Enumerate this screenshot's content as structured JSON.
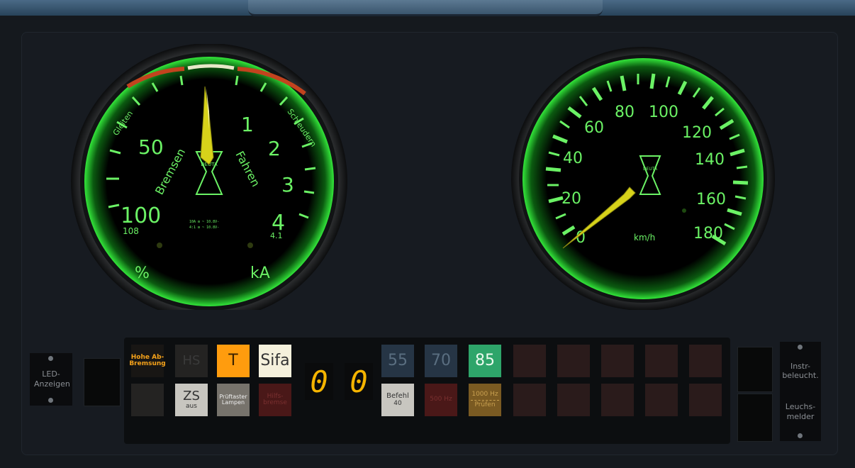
{
  "gauges": {
    "traction": {
      "arc_left": "Gleiten",
      "arc_right": "Schleudern",
      "label_left": "Bremsen",
      "label_right": "Fahren",
      "logo": "DEUTA",
      "ticks_left": [
        "50",
        "100"
      ],
      "ticks_right": [
        "1",
        "2",
        "3",
        "4"
      ],
      "max_left": "108",
      "max_right": "4.1",
      "unit_left": "%",
      "unit_right": "kA",
      "needle_color": "#d7d21a",
      "glow_color": "#39e53a"
    },
    "speed": {
      "logo": "DEUTA",
      "ticks": [
        "0",
        "20",
        "40",
        "60",
        "80",
        "100",
        "120",
        "140",
        "160",
        "180"
      ],
      "unit": "km/h",
      "needle_color": "#d7d21a",
      "glow_color": "#39e53a"
    }
  },
  "led_panel": {
    "label": "LED-Anzeigen",
    "lamps_top": {
      "hohe_ab_bremsung": "Hohe Ab-Bremsung",
      "hs": "HS",
      "t": "T",
      "sifa": "Sifa",
      "l55": "55",
      "l70": "70",
      "l85": "85"
    },
    "lamps_bottom": {
      "zs": "ZS",
      "zs_sub": "aus",
      "pruef": "Prüftaster Lampen",
      "hilfsbremse": "Hilfs- bremse",
      "befehl": "Befehl",
      "befehl_sub": "40",
      "hz500": "500 Hz",
      "hz1000": "1000 Hz",
      "pruefen": "Prüfen"
    },
    "display_digits": [
      "0",
      "0"
    ]
  },
  "right_panel": {
    "instr": "Instr-beleucht.",
    "leuchtmelder": "Leuchs-melder"
  },
  "colors": {
    "lamp_t": "#ff9c0e",
    "lamp_sifa": "#f5f1dc",
    "lamp_85": "#2ea56a",
    "digit": "#f5b400"
  }
}
